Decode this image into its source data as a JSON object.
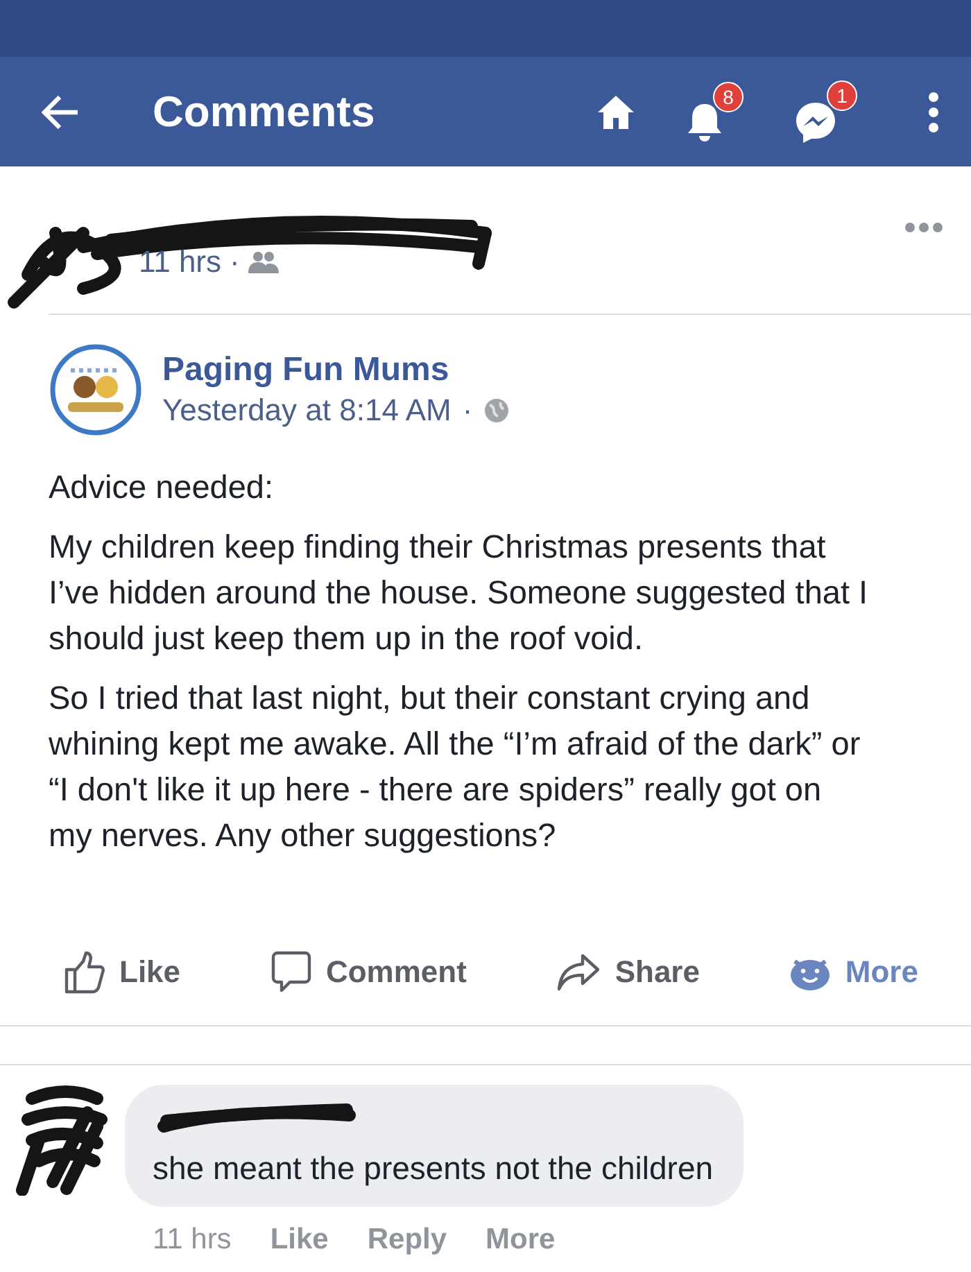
{
  "header": {
    "title": "Comments",
    "notifications_badge": "8",
    "messages_badge": "1"
  },
  "post": {
    "time": "11 hrs",
    "separator": "·",
    "shared": {
      "page_name": "Paging Fun Mums",
      "time": "Yesterday at 8:14 AM",
      "separator": "·",
      "paragraphs": [
        "Advice needed:",
        "My children keep finding their Christmas presents that I’ve hidden around the house. Someone suggested that I should just keep them up in the roof void.",
        "So I tried that last night, but their constant crying and whining kept me awake. All the “I’m afraid of the dark” or “I don't like it up here - there are spiders” really got on my nerves. Any other suggestions?"
      ]
    },
    "actions": [
      {
        "label": "Like",
        "kind": "like"
      },
      {
        "label": "Comment",
        "kind": "comment"
      },
      {
        "label": "Share",
        "kind": "share"
      },
      {
        "label": "More",
        "kind": "more"
      }
    ]
  },
  "comment": {
    "text": "she meant the presents not the children",
    "time": "11 hrs",
    "actions": [
      "Like",
      "Reply",
      "More"
    ]
  }
}
